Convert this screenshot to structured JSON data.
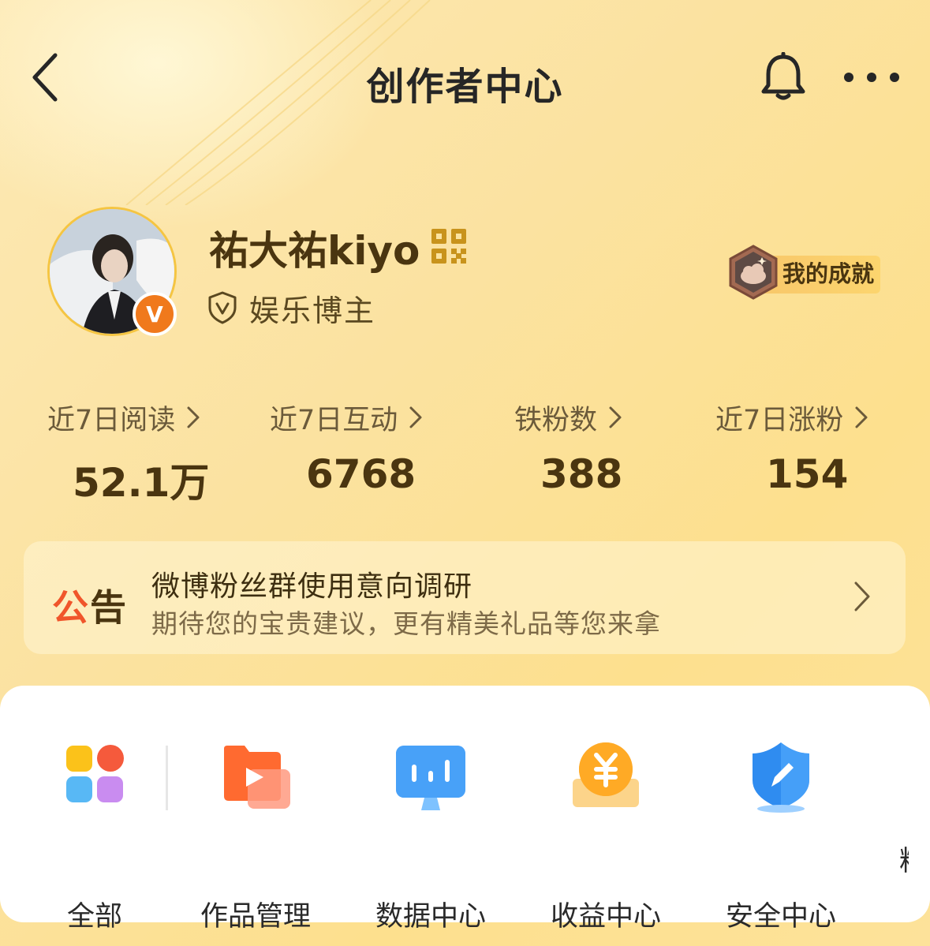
{
  "header": {
    "title": "创作者中心"
  },
  "profile": {
    "username": "祐大祐kiyo",
    "role": "娱乐博主",
    "verified_badge": "V"
  },
  "achievement": {
    "label": "我的成就"
  },
  "stats": [
    {
      "label": "近7日阅读",
      "value": "52.1万"
    },
    {
      "label": "近7日互动",
      "value": "6768"
    },
    {
      "label": "铁粉数",
      "value": "388"
    },
    {
      "label": "近7日涨粉",
      "value": "154"
    }
  ],
  "notice": {
    "tag_first": "公",
    "tag_second": "告",
    "title": "微博粉丝群使用意向调研",
    "subtitle": "期待您的宝贵建议，更有精美礼品等您来拿"
  },
  "tools": [
    {
      "label": "全部",
      "icon": "grid-apps-icon"
    },
    {
      "label": "作品管理",
      "icon": "video-folder-icon"
    },
    {
      "label": "数据中心",
      "icon": "data-chart-icon"
    },
    {
      "label": "收益中心",
      "icon": "yuan-coin-icon"
    },
    {
      "label": "安全中心",
      "icon": "shield-pen-icon"
    },
    {
      "label": "粉",
      "icon": ""
    }
  ],
  "colors": {
    "brand_orange": "#f0791c",
    "text_dark": "#4a3510",
    "notice_red": "#f0552b"
  }
}
